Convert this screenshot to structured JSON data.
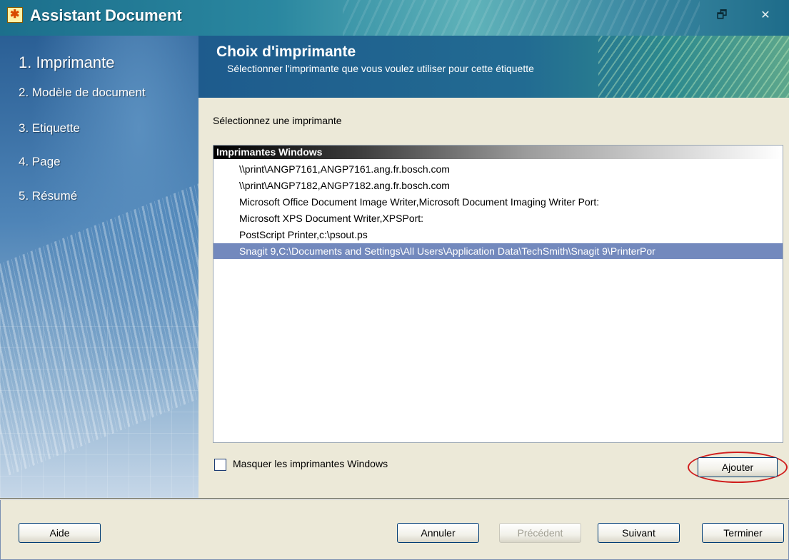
{
  "window": {
    "title": "Assistant Document"
  },
  "steps": [
    {
      "label": "1. Imprimante"
    },
    {
      "label": "2. Modèle de document"
    },
    {
      "label": "3. Etiquette"
    },
    {
      "label": "4. Page"
    },
    {
      "label": "5. Résumé"
    }
  ],
  "banner": {
    "title": "Choix d'imprimante",
    "subtitle": "Sélectionner l'imprimante que vous voulez utiliser pour cette étiquette"
  },
  "main": {
    "select_label": "Sélectionnez une imprimante",
    "group_header": "Imprimantes Windows",
    "printers": [
      "\\\\print\\ANGP7161,ANGP7161.ang.fr.bosch.com",
      "\\\\print\\ANGP7182,ANGP7182.ang.fr.bosch.com",
      "Microsoft Office Document Image Writer,Microsoft Document Imaging Writer Port:",
      "Microsoft XPS Document Writer,XPSPort:",
      "PostScript Printer,c:\\psout.ps",
      "Snagit 9,C:\\Documents and Settings\\All Users\\Application Data\\TechSmith\\Snagit 9\\PrinterPor"
    ],
    "selected_index": 5,
    "hide_checkbox_label": "Masquer les imprimantes Windows",
    "hide_checked": false,
    "add_button": "Ajouter"
  },
  "footer": {
    "help": "Aide",
    "cancel": "Annuler",
    "previous": "Précédent",
    "next": "Suivant",
    "finish": "Terminer"
  },
  "colors": {
    "selection": "#7389bd",
    "highlight_ring": "#d01d1d",
    "banner": "#1e5b8d"
  }
}
